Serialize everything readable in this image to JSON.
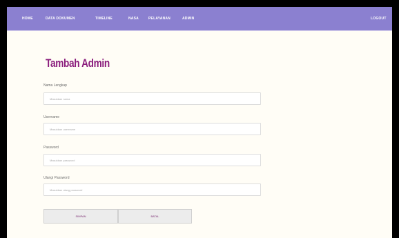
{
  "navbar": {
    "items": [
      {
        "label": "HOME"
      },
      {
        "label": "DATA DOKUMEN"
      },
      {
        "label": "TIMELINE"
      },
      {
        "label": "NASA"
      },
      {
        "label": "PELAYANAN"
      },
      {
        "label": "ADMIN"
      }
    ],
    "logout_label": "LOGOUT",
    "color": "#8b80d0"
  },
  "form": {
    "title": "Tambah Admin",
    "title_color": "#8a1c7c",
    "fields": [
      {
        "label": "Nama Lengkap",
        "placeholder": "Masukkan nama"
      },
      {
        "label": "Username",
        "placeholder": "Masukkan username"
      },
      {
        "label": "Password",
        "placeholder": "Masukkan password"
      },
      {
        "label": "Ulangi Password",
        "placeholder": "Masukkan ulang password"
      }
    ],
    "submit_label": "SIMPAN",
    "reset_label": "BATAL"
  }
}
